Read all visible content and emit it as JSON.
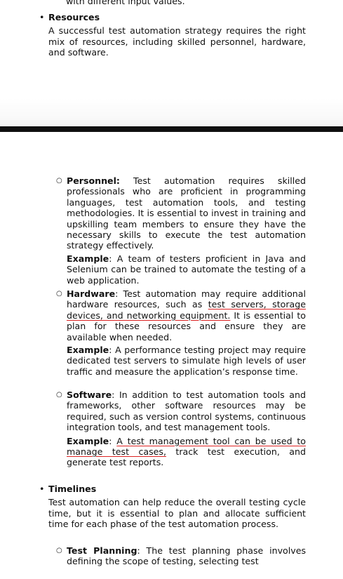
{
  "top_fragment": "with different input values.",
  "resources": {
    "heading": "Resources",
    "body": "A successful test automation strategy requires the right mix of resources, including skilled personnel, hardware, and software."
  },
  "personnel": {
    "label": "Personnel:",
    "text": " Test automation requires skilled professionals who are proficient in programming languages, test automation tools, and testing methodologies. It is essential to invest in training and upskilling team members to ensure they have the necessary skills to execute the test automation strategy effectively.",
    "example_label": "Example",
    "example_text": ": A team of testers proficient in Java and Selenium can be trained to automate the testing of a web application."
  },
  "hardware": {
    "label": "Hardware",
    "text_a": ": Test automation may require additional hardware resources, such as ",
    "text_ul": "test servers, storage devices, and networking equipment.",
    "text_b": " It is essential to plan for these resources and ensure they are available when needed.",
    "example_label": "Example",
    "example_text": ": A performance testing project may require dedicated test servers to simulate high levels of user traffic and measure the application’s response time."
  },
  "software": {
    "label": "Software",
    "text": ": In addition to test automation tools and frameworks, other software resources may be required, such as version control systems, continuous integration tools, and test management tools.",
    "example_label": "Example",
    "example_colon": ": ",
    "example_ul": "A test management tool can be used to manage test cases,",
    "example_rest": " track test execution, and generate test reports."
  },
  "timelines": {
    "heading": "Timelines",
    "body": "Test automation can help reduce the overall testing cycle time, but it is essential to plan and allocate sufficient time for each phase of the test automation process."
  },
  "test_planning": {
    "label": "Test Planning",
    "text": ": The test planning phase involves defining the scope of testing, selecting test"
  }
}
